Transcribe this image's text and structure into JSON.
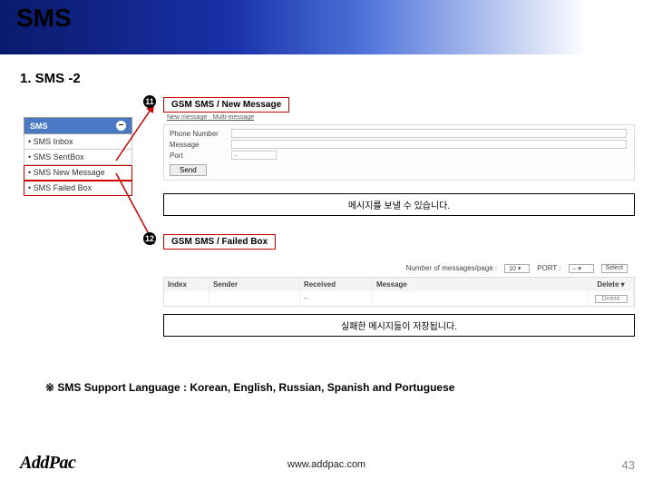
{
  "header": {
    "title": "SMS"
  },
  "subtitle": "1. SMS -2",
  "menu": {
    "header": "SMS",
    "items": [
      {
        "label": "SMS Inbox",
        "highlight": false
      },
      {
        "label": "SMS SentBox",
        "highlight": false
      },
      {
        "label": "SMS New Message",
        "highlight": true
      },
      {
        "label": "SMS Failed Box",
        "highlight": true
      }
    ]
  },
  "block11": {
    "circle": "11",
    "heading": "GSM SMS / New Message",
    "sub": "New message · Multi-message",
    "form": {
      "phone_label": "Phone Number",
      "msg_label": "Message",
      "port_label": "Port",
      "port_value": "–",
      "send_label": "Send"
    },
    "caption": "메시지를 보낼 수 있습니다."
  },
  "block12": {
    "circle": "12",
    "heading": "GSM SMS / Failed Box",
    "controls": {
      "count_label": "Number of messages/page :",
      "count_value": "10 ▾",
      "port_label": "PORT :",
      "port_value": "–    ▾",
      "select_btn": "Select"
    },
    "table": {
      "headers": {
        "idx": "Index",
        "snd": "Sender",
        "rcv": "Received",
        "msg": "Message",
        "del": "Delete ▾"
      },
      "row": {
        "idx": "",
        "snd": "",
        "rcv": "–",
        "msg": "",
        "del": "Delete"
      }
    },
    "caption": "실패한 메시지들이 저장됩니다."
  },
  "support_note": "※ SMS Support Language : Korean, English, Russian, Spanish and Portuguese",
  "footer": {
    "logo": "AddPac",
    "url": "www.addpac.com",
    "page": "43"
  }
}
